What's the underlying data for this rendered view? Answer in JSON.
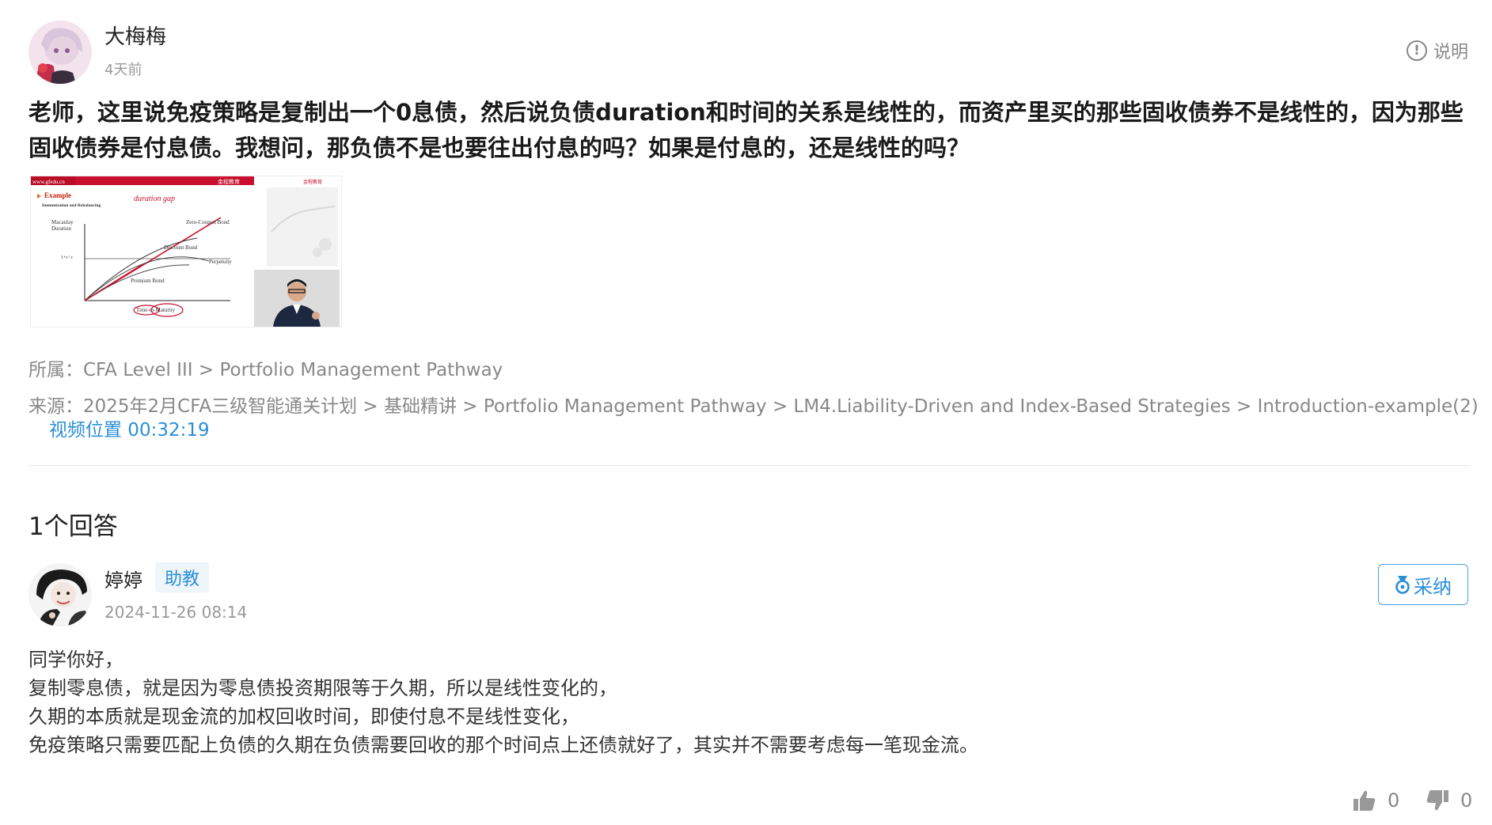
{
  "question": {
    "author": "大梅梅",
    "time": "4天前",
    "explain_label": "说明",
    "text": "老师，这里说免疫策略是复制出一个0息债，然后说负债duration和时间的关系是线性的，而资产里买的那些固收债券不是线性的，因为那些固收债券是付息债。我想问，那负债不是也要往出付息的吗？如果是付息的，还是线性的吗？",
    "belong": "所属：CFA Level III > Portfolio Management Pathway",
    "source": "来源：2025年2月CFA三级智能通关计划 > 基础精讲 > Portfolio Management Pathway > LM4.Liability-Driven and Index-Based Strategies > Introduction-example(2)",
    "video_position": "视频位置 00:32:19"
  },
  "slide": {
    "url_text": "www.gfedu.cn",
    "logo_text": "金程教育",
    "example_label": "Example",
    "subtitle": "Immunization and Rebalancing",
    "handwritten": "duration gap",
    "ylabel_line1": "Macaulay",
    "ylabel_line2": "Duration",
    "y_tick": "1+r / r",
    "xlabel": "Time-to-Maturity",
    "curves": [
      "Zero-Coupon Bond",
      "Discount Bond",
      "Perpetuity",
      "Premium Bond"
    ]
  },
  "answers": {
    "count_label": "1个回答",
    "items": [
      {
        "author": "婷婷",
        "badge": "助教",
        "time": "2024-11-26 08:14",
        "adopt_label": "采纳",
        "lines": [
          "同学你好，",
          "复制零息债，就是因为零息债投资期限等于久期，所以是线性变化的，",
          "久期的本质就是现金流的加权回收时间，即使付息不是线性变化，",
          "免疫策略只需要匹配上负债的久期在负债需要回收的那个时间点上还债就好了，其实并不需要考虑每一笔现金流。"
        ],
        "likes": "0",
        "dislikes": "0"
      }
    ]
  },
  "icons": {
    "info": "info-icon",
    "adopt": "medal-icon",
    "like": "thumbs-up-icon",
    "dislike": "thumbs-down-icon"
  },
  "colors": {
    "link_blue": "#2a8fd8",
    "slide_red": "#c8102e"
  }
}
